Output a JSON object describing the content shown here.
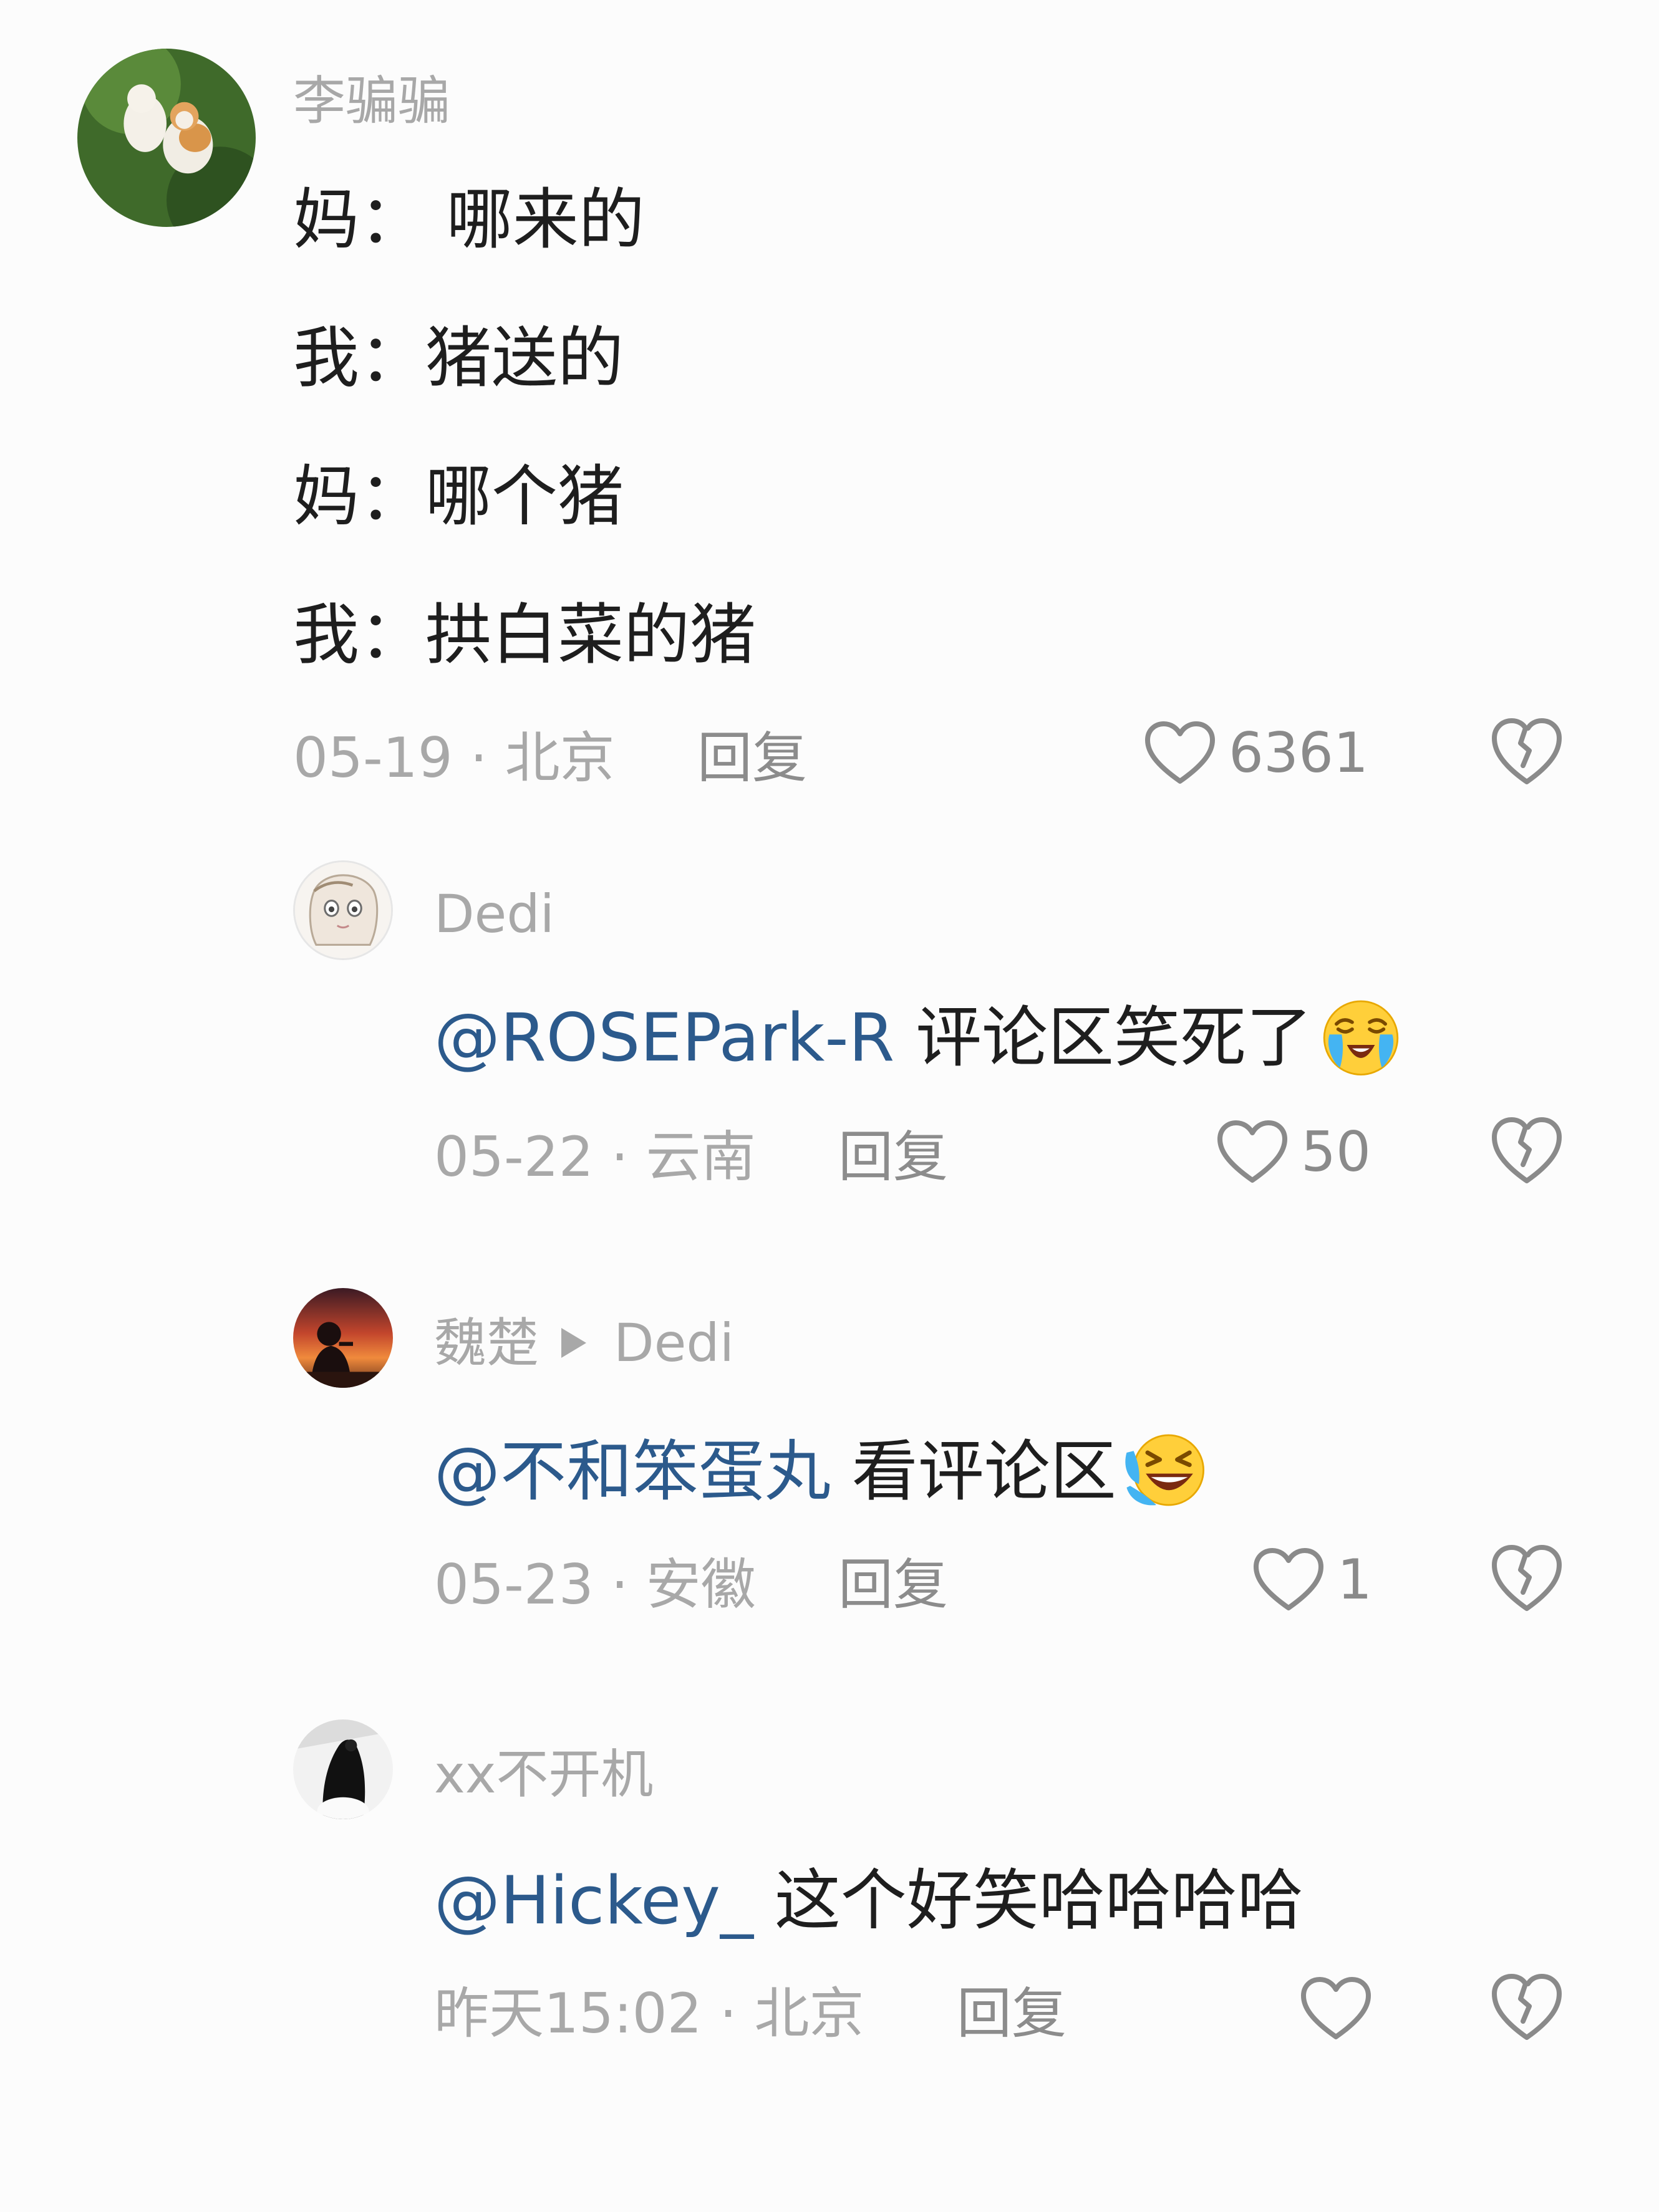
{
  "comments": [
    {
      "username": "李骗骗",
      "lines": [
        "妈：  哪来的",
        "我：猪送的",
        "妈：哪个猪",
        "我：拱白菜的猪"
      ],
      "meta": "05-19 · 北京",
      "reply_label": "回复",
      "likes": "6361",
      "avatar_icon": "kittens-avatar-icon"
    },
    {
      "username": "Dedi",
      "mention": "@ROSEPark-R",
      "text": " 评论区笑死了",
      "emoji": "crying-face-emoji",
      "meta": "05-22 · 云南",
      "reply_label": "回复",
      "likes": "50",
      "avatar_icon": "anime-girl-avatar-icon"
    },
    {
      "username": "魏楚",
      "reply_to": "Dedi",
      "mention": "@不和笨蛋丸",
      "text": " 看评论区",
      "emoji": "laughing-tears-emoji",
      "meta": "05-23 · 安徽",
      "reply_label": "回复",
      "likes": "1",
      "avatar_icon": "sunset-silhouette-avatar-icon"
    },
    {
      "username": "xx不开机",
      "mention": "@Hickey_",
      "text": " 这个好笑哈哈哈哈",
      "meta": "昨天15:02 · 北京",
      "reply_label": "回复",
      "likes": "",
      "avatar_icon": "black-white-avatar-icon"
    }
  ],
  "colors": {
    "background": "#fcfcfc",
    "mention": "#2c5a8c",
    "muted": "#a8a8a8",
    "text": "#1e1e1e"
  },
  "icons": {
    "like": "heart-outline-icon",
    "dislike": "broken-heart-icon"
  }
}
